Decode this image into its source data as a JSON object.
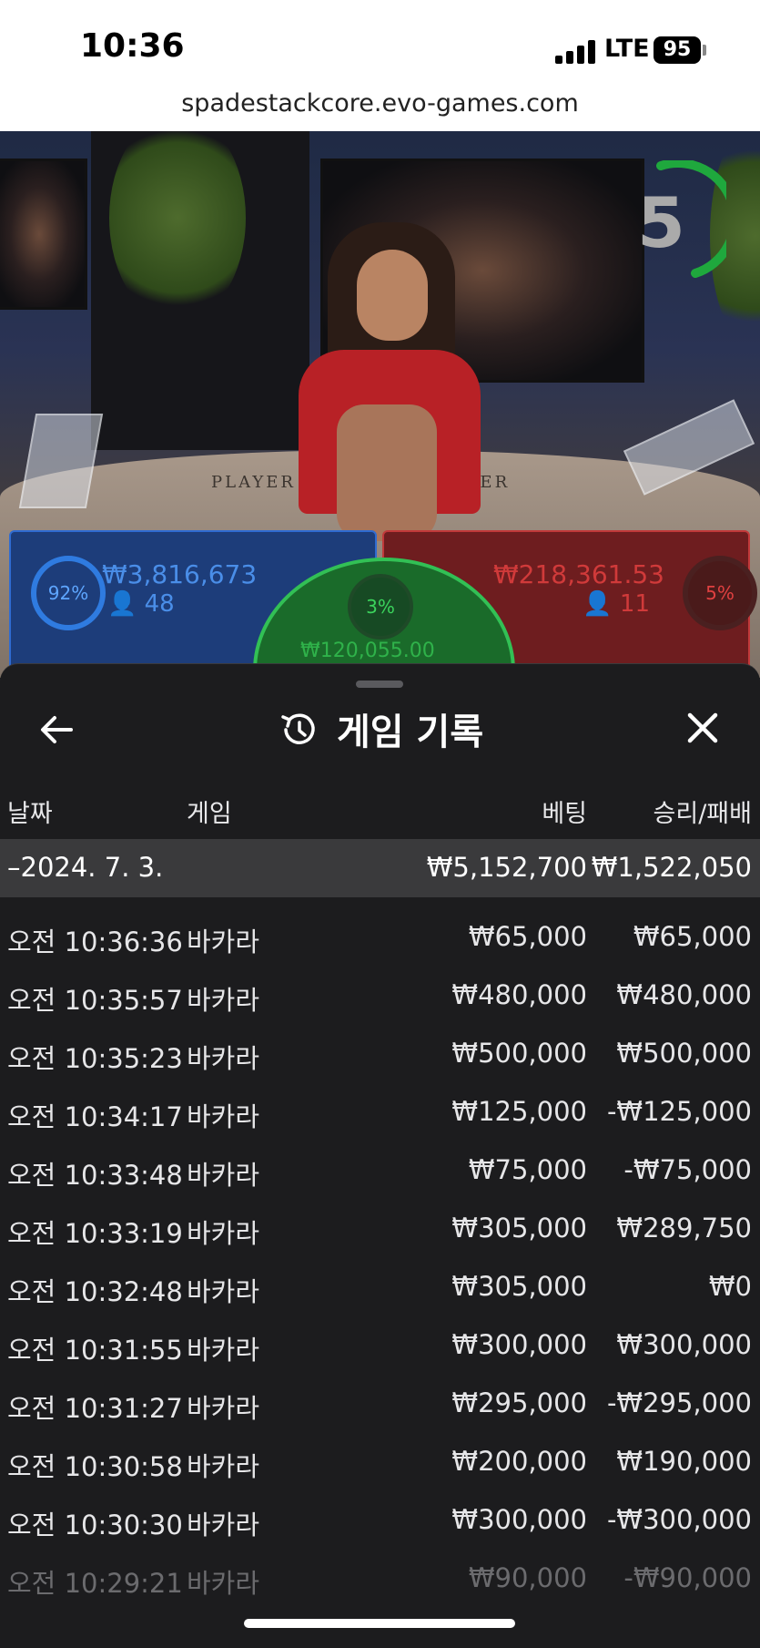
{
  "status_bar": {
    "time": "10:36",
    "network": "LTE",
    "battery": "95"
  },
  "browser": {
    "url": "spadestackcore.evo-games.com"
  },
  "video": {
    "countdown": "5",
    "table_labels": {
      "player": "PLAYER",
      "banker": "BANKER"
    }
  },
  "bets": {
    "player": {
      "percent": "92%",
      "amount": "₩3,816,673",
      "players": "48"
    },
    "tie": {
      "percent": "3%",
      "amount": "₩120,055.00"
    },
    "banker": {
      "percent": "5%",
      "amount": "₩218,361.53",
      "players": "11"
    }
  },
  "history": {
    "title": "게임 기록",
    "columns": {
      "date": "날짜",
      "game": "게임",
      "bet": "베팅",
      "win_loss": "승리/패배"
    },
    "day_summary": {
      "date": "–2024. 7. 3.",
      "bet": "₩5,152,700",
      "win_loss": "₩1,522,050"
    },
    "rows": [
      {
        "time": "오전 10:36:36",
        "game": "바카라",
        "bet": "₩65,000",
        "win_loss": "₩65,000"
      },
      {
        "time": "오전 10:35:57",
        "game": "바카라",
        "bet": "₩480,000",
        "win_loss": "₩480,000"
      },
      {
        "time": "오전 10:35:23",
        "game": "바카라",
        "bet": "₩500,000",
        "win_loss": "₩500,000"
      },
      {
        "time": "오전 10:34:17",
        "game": "바카라",
        "bet": "₩125,000",
        "win_loss": "-₩125,000"
      },
      {
        "time": "오전 10:33:48",
        "game": "바카라",
        "bet": "₩75,000",
        "win_loss": "-₩75,000"
      },
      {
        "time": "오전 10:33:19",
        "game": "바카라",
        "bet": "₩305,000",
        "win_loss": "₩289,750"
      },
      {
        "time": "오전 10:32:48",
        "game": "바카라",
        "bet": "₩305,000",
        "win_loss": "₩0"
      },
      {
        "time": "오전 10:31:55",
        "game": "바카라",
        "bet": "₩300,000",
        "win_loss": "₩300,000"
      },
      {
        "time": "오전 10:31:27",
        "game": "바카라",
        "bet": "₩295,000",
        "win_loss": "-₩295,000"
      },
      {
        "time": "오전 10:30:58",
        "game": "바카라",
        "bet": "₩200,000",
        "win_loss": "₩190,000"
      },
      {
        "time": "오전 10:30:30",
        "game": "바카라",
        "bet": "₩300,000",
        "win_loss": "-₩300,000"
      },
      {
        "time": "오전 10:29:21",
        "game": "바카라",
        "bet": "₩90,000",
        "win_loss": "-₩90,000"
      }
    ]
  },
  "colors": {
    "player": "#2f7be0",
    "banker": "#c1393a",
    "tie": "#32c055",
    "sheet_bg": "#1c1c1e"
  }
}
